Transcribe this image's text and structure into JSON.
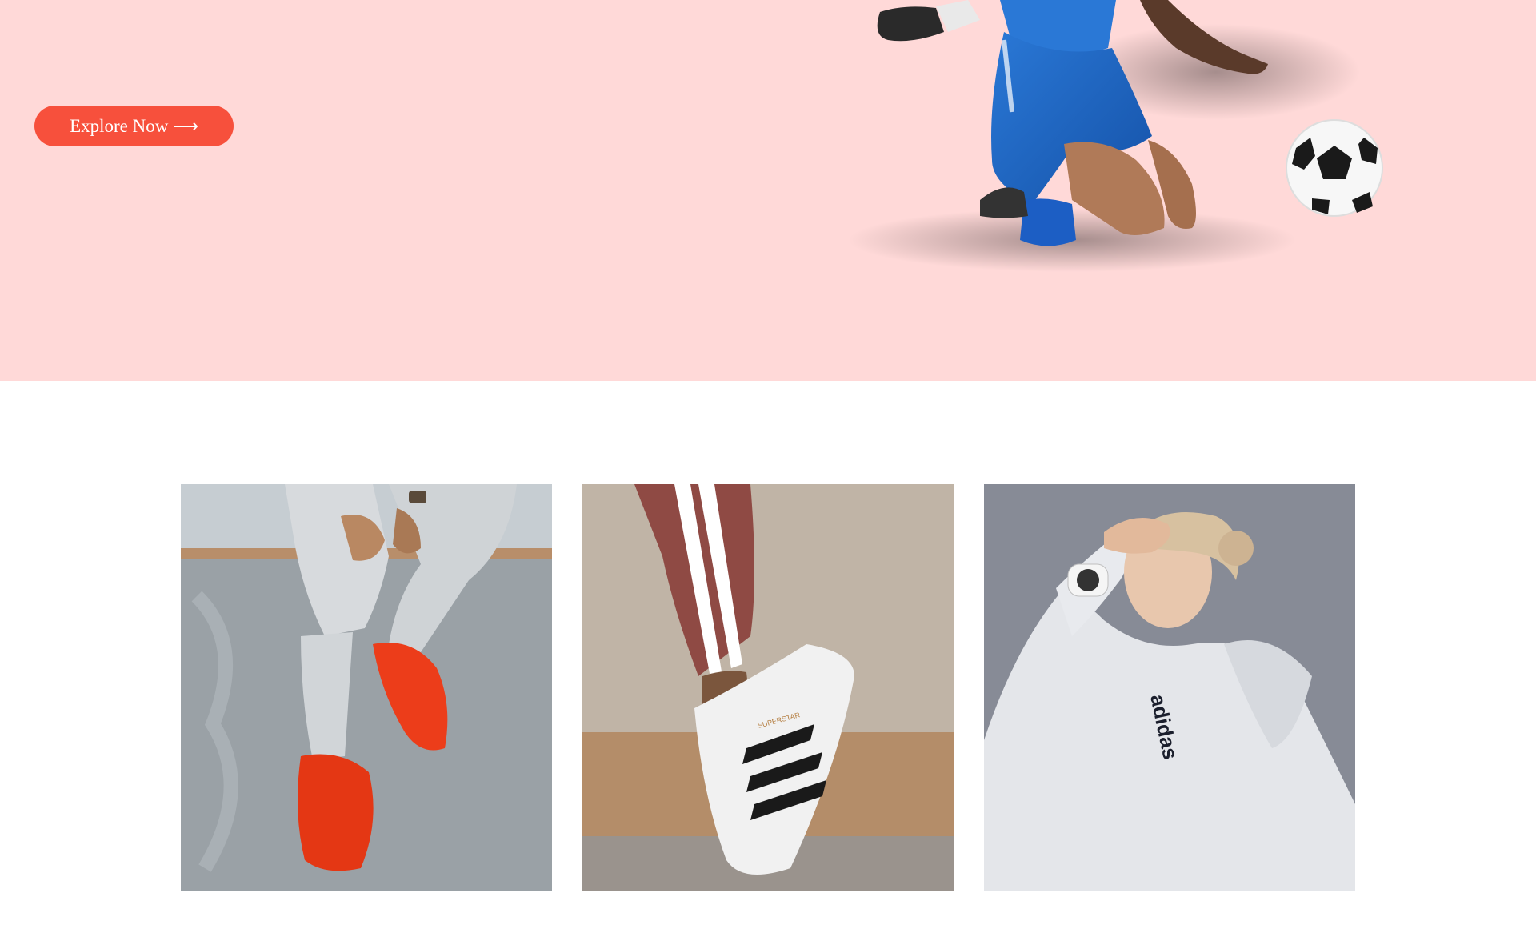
{
  "hero": {
    "cta_label": "Explore Now",
    "cta_arrow": "⟶",
    "background_color": "#ffd9d8",
    "accent_color": "#f7503c",
    "image": "soccer-player-with-ball"
  },
  "gallery": {
    "tiles": [
      {
        "image": "red-sneakers-on-ledge"
      },
      {
        "image": "white-superstar-sneaker"
      },
      {
        "image": "woman-in-white-hoodie"
      }
    ],
    "shoe_brand_text": "SUPERSTAR",
    "hoodie_brand_text": "adidas"
  }
}
